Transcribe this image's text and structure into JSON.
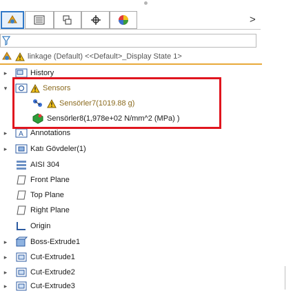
{
  "toolbar": {
    "tabs": [
      {
        "icon": "feature-manager-icon"
      },
      {
        "icon": "property-manager-icon"
      },
      {
        "icon": "configuration-manager-icon"
      },
      {
        "icon": "dimxpert-manager-icon"
      },
      {
        "icon": "display-manager-icon"
      }
    ],
    "more_label": ">"
  },
  "root": {
    "label": "linkage (Default) <<Default>_Display State 1>"
  },
  "tree": {
    "history": "History",
    "sensors": "Sensors",
    "sensor1": "Sensörler7(1019.88 g)",
    "sensor2": "Sensörler8(1,978e+02 N/mm^2 (MPa) )",
    "annotations": "Annotations",
    "solid_bodies": "Katı Gövdeler(1)",
    "material": "AISI 304",
    "front_plane": "Front Plane",
    "top_plane": "Top Plane",
    "right_plane": "Right Plane",
    "origin": "Origin",
    "boss_extrude1": "Boss-Extrude1",
    "cut_extrude1": "Cut-Extrude1",
    "cut_extrude2": "Cut-Extrude2",
    "cut_extrude3": "Cut-Extrude3"
  },
  "colors": {
    "highlight": "#e0151e",
    "accent": "#2f78c8",
    "warning": "#f2c21b"
  }
}
